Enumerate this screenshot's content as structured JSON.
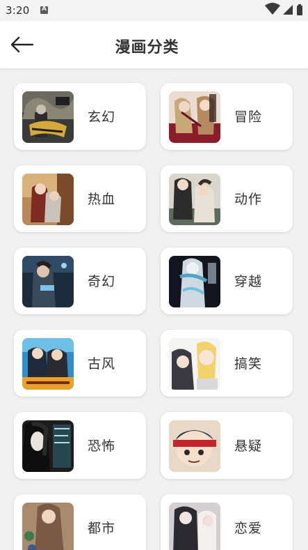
{
  "status_bar": {
    "time": "3:20"
  },
  "header": {
    "title": "漫画分类"
  },
  "categories": [
    {
      "label": "玄幻",
      "cover": "xuanhuan-cover"
    },
    {
      "label": "冒险",
      "cover": "maoxian-cover"
    },
    {
      "label": "热血",
      "cover": "rexue-cover"
    },
    {
      "label": "动作",
      "cover": "dongzuo-cover"
    },
    {
      "label": "奇幻",
      "cover": "qihuan-cover"
    },
    {
      "label": "穿越",
      "cover": "chuanyue-cover"
    },
    {
      "label": "古风",
      "cover": "gufeng-cover"
    },
    {
      "label": "搞笑",
      "cover": "gaoxiao-cover"
    },
    {
      "label": "恐怖",
      "cover": "kongbu-cover"
    },
    {
      "label": "悬疑",
      "cover": "xuanyi-cover"
    },
    {
      "label": "都市",
      "cover": "dushi-cover"
    },
    {
      "label": "恋爱",
      "cover": "lianai-cover"
    }
  ]
}
